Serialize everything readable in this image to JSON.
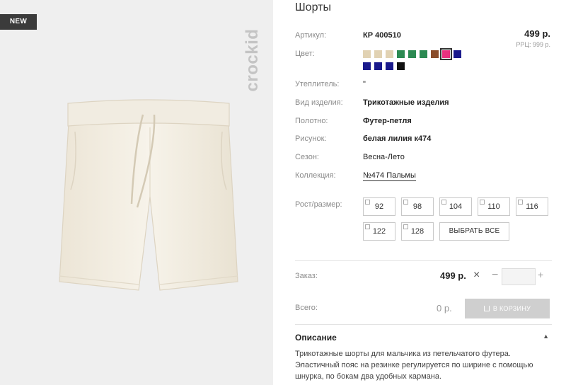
{
  "badge": "NEW",
  "brand": "crockid",
  "product": {
    "title": "Шорты",
    "price": "499 р.",
    "rrp": "РРЦ: 999 р."
  },
  "attributes": {
    "article_label": "Артикул:",
    "article_value": "КР 400510",
    "color_label": "Цвет:",
    "insulation_label": "Утеплитель:",
    "insulation_value": "\"",
    "type_label": "Вид изделия:",
    "type_value": "Трикотажные изделия",
    "fabric_label": "Полотно:",
    "fabric_value": "Футер-петля",
    "pattern_label": "Рисунок:",
    "pattern_value": "белая лилия к474",
    "season_label": "Сезон:",
    "season_value": "Весна-Лето",
    "collection_label": "Коллекция:",
    "collection_value": "№474 Пальмы"
  },
  "colors": [
    "#e1d2b3",
    "#e1d2b3",
    "#e1d2b3",
    "#2c8a52",
    "#2c8a52",
    "#2c8a52",
    "#8a4d2b",
    "#e8317f",
    "#1a1a8c",
    "#1a1a8c",
    "#1a1a8c",
    "#1a1a8c",
    "#111111"
  ],
  "sizes": {
    "label": "Рост/размер:",
    "options": [
      "92",
      "98",
      "104",
      "110",
      "116",
      "122",
      "128"
    ],
    "select_all": "ВЫБРАТЬ ВСЕ"
  },
  "order": {
    "label": "Заказ:",
    "price": "499 р.",
    "times": "×",
    "minus": "−",
    "plus": "+",
    "quantity": ""
  },
  "total": {
    "label": "Всего:",
    "value": "0 р.",
    "button": "В КОРЗИНУ"
  },
  "description": {
    "title": "Описание",
    "lines": [
      "Трикотажные шорты для мальчика из петельчатого футера.",
      "Эластичный пояс на резинке регулируется по ширине с помощью",
      "шнурка, по бокам два удобных кармана."
    ]
  }
}
